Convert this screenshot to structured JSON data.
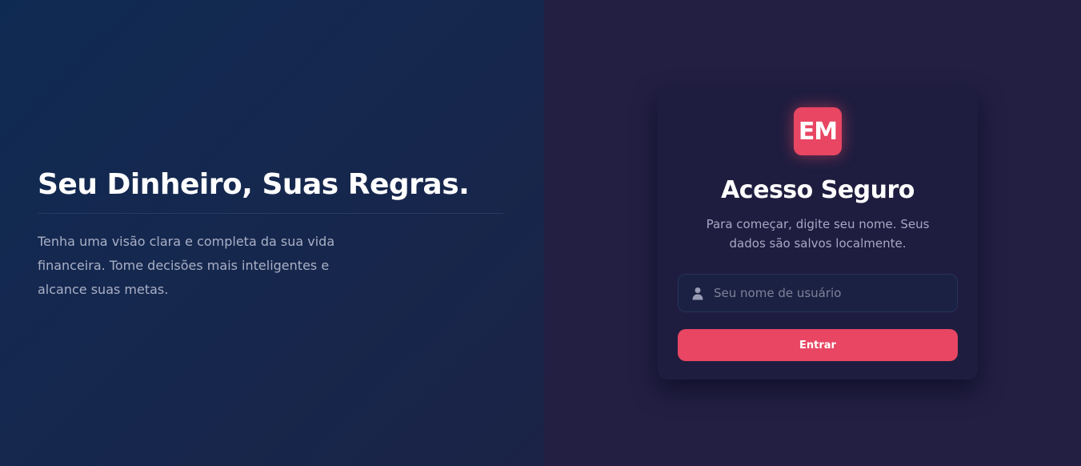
{
  "hero": {
    "title": "Seu Dinheiro, Suas Regras.",
    "description": "Tenha uma visão clara e completa da sua vida financeira. Tome decisões mais inteligentes e alcance suas metas."
  },
  "login": {
    "logo_text": "EM",
    "title": "Acesso Seguro",
    "subtitle": "Para começar, digite seu nome. Seus dados são salvos localmente.",
    "username_placeholder": "Seu nome de usuário",
    "username_value": "",
    "submit_label": "Entrar",
    "input_icon": "user-icon"
  },
  "colors": {
    "accent": "#e84663",
    "left_background": "#13294f",
    "right_background": "#221f42",
    "card_background": "#1f1d3f"
  }
}
